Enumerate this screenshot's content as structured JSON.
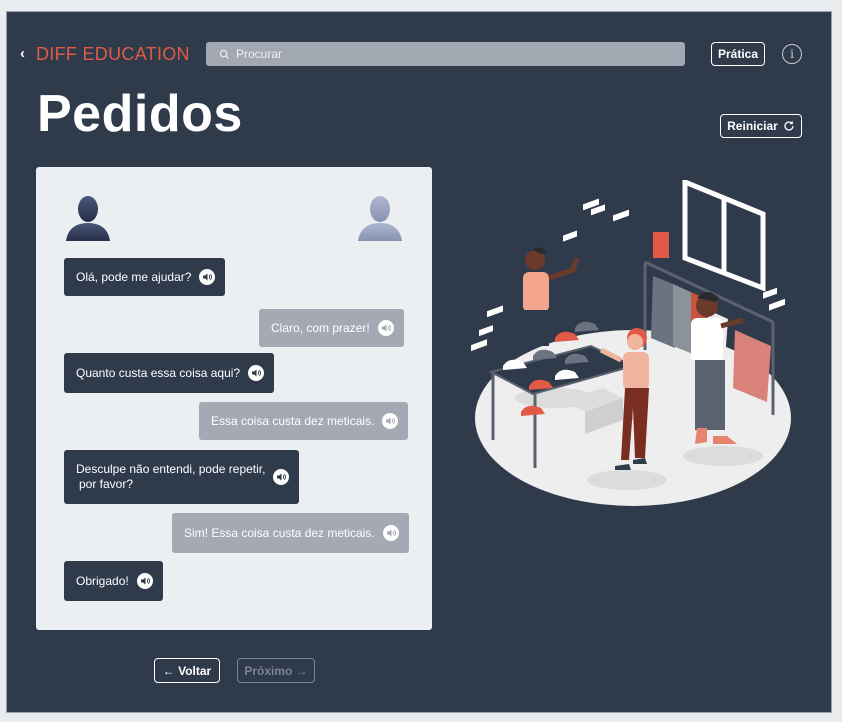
{
  "header": {
    "back_glyph": "‹",
    "brand": "DIFF EDUCATION",
    "search_placeholder": "Procurar",
    "practice_label": "Prática",
    "info_glyph": "i"
  },
  "page": {
    "title": "Pedidos",
    "restart_label": "Reiniciar"
  },
  "dialogue": [
    {
      "speaker": "left",
      "text": "Olá, pode me ajudar?"
    },
    {
      "speaker": "right",
      "text": "Claro, com prazer!"
    },
    {
      "speaker": "left",
      "text": "Quanto custa essa coisa aqui?"
    },
    {
      "speaker": "right",
      "text": "Essa coisa custa dez meticais."
    },
    {
      "speaker": "left",
      "line1": "Desculpe não entendi, pode repetir,",
      "line2": "por favor?"
    },
    {
      "speaker": "right",
      "text": "Sim! Essa coisa custa dez meticais."
    },
    {
      "speaker": "left",
      "text": "Obrigado!"
    }
  ],
  "nav": {
    "back_label": "← Voltar",
    "next_label": "Próximo →"
  },
  "colors": {
    "background": "#2f3a4b",
    "brand": "#e05a47",
    "panel": "#eceff1",
    "bubble_dark": "#2f3a4b",
    "bubble_light": "#a4a9b3"
  },
  "icons": [
    "search-icon",
    "info-icon",
    "refresh-icon",
    "speaker-icon",
    "user-avatar-icon"
  ]
}
